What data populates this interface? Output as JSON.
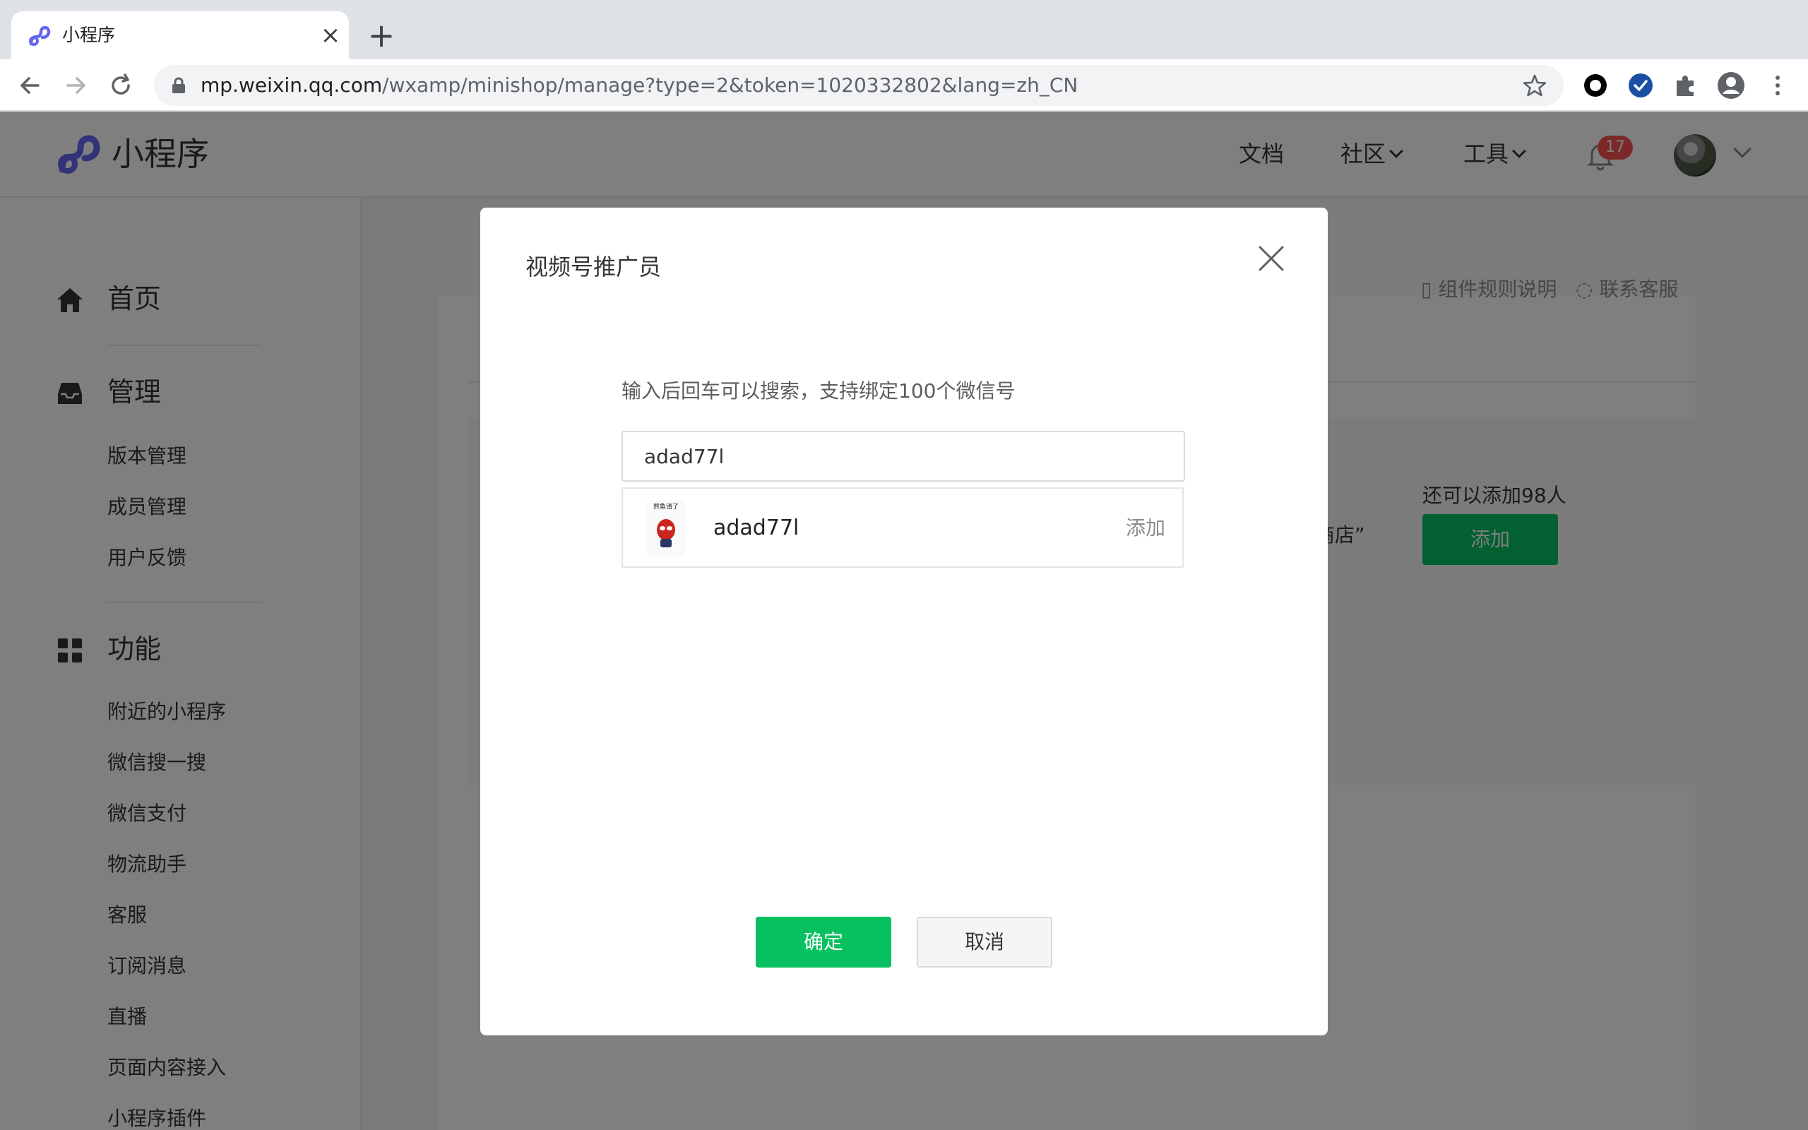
{
  "browser": {
    "tab_title": "小程序",
    "tab_close": "×",
    "new_tab": "+",
    "url_host": "mp.weixin.qq.com",
    "url_path": "/wxamp/minishop/manage?type=2&token=1020332802&lang=zh_CN"
  },
  "header": {
    "logo_text": "小程序",
    "nav_docs": "文档",
    "nav_community": "社区",
    "nav_tools": "工具",
    "notification_count": "17"
  },
  "sidebar": {
    "home": "首页",
    "manage": "管理",
    "manage_items": [
      "版本管理",
      "成员管理",
      "用户反馈"
    ],
    "features": "功能",
    "feature_items": [
      "附近的小程序",
      "微信搜一搜",
      "微信支付",
      "物流助手",
      "客服",
      "订阅消息",
      "直播",
      "页面内容接入",
      "小程序插件"
    ]
  },
  "content": {
    "link_rules": "组件规则说明",
    "link_support": "联系客服",
    "remaining": "还可以添加98人",
    "add_label": "添加",
    "shop_fragment": "商店”"
  },
  "modal": {
    "title": "视频号推广员",
    "hint": "输入后回车可以搜索，支持绑定100个微信号",
    "search_value": "adad77l",
    "result_name": "adad77l",
    "result_add": "添加",
    "confirm": "确定",
    "cancel": "取消"
  },
  "colors": {
    "brand_green": "#07c160",
    "badge_red": "#fa5151",
    "logo_purple": "#6467f0"
  }
}
